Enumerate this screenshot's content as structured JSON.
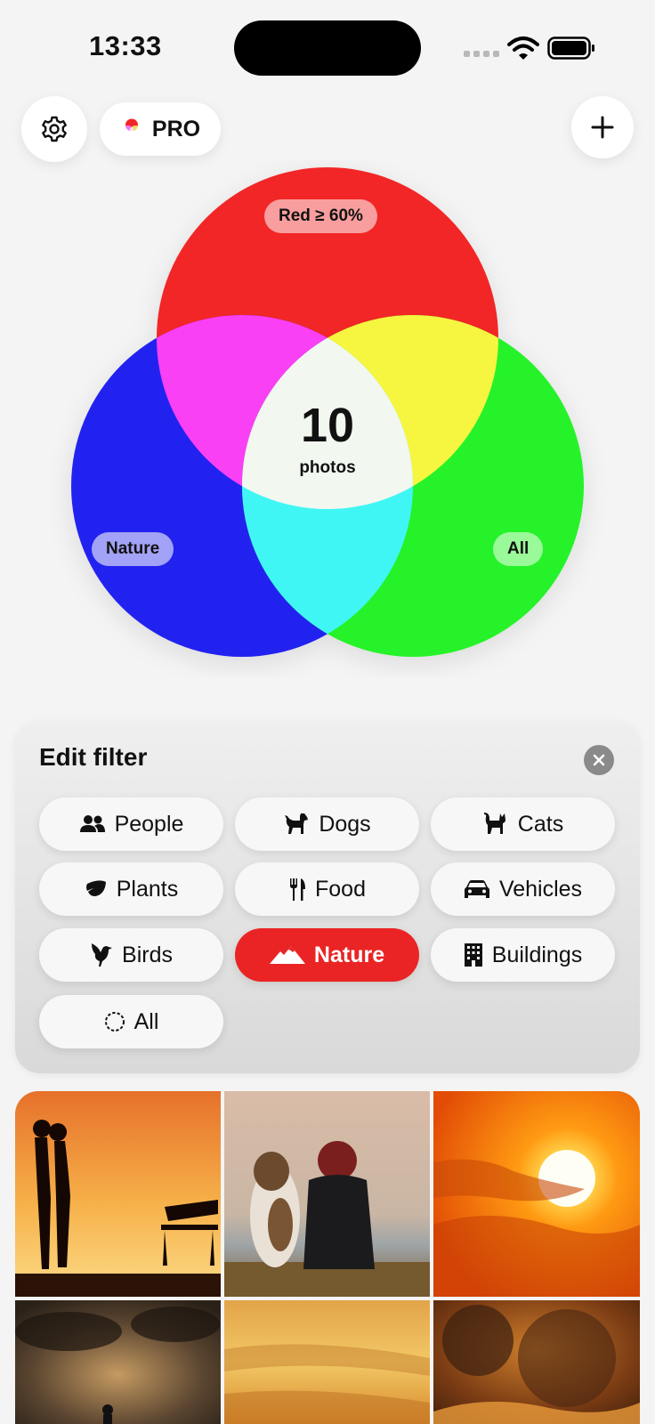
{
  "status": {
    "time": "13:33"
  },
  "toolbar": {
    "pro_label": "PRO"
  },
  "venn": {
    "labels": {
      "top": "Red ≥ 60%",
      "left": "Nature",
      "right": "All"
    },
    "count": "10",
    "count_unit": "photos",
    "colors": {
      "red": "#f22528",
      "green": "#25f22a",
      "blue": "#2222f0",
      "magenta": "#f940f5",
      "yellow": "#f6f640",
      "cyan": "#40f6f4",
      "center": "#f2f7f0"
    }
  },
  "filter": {
    "title": "Edit filter",
    "chips": [
      {
        "label": "People",
        "icon": "people-icon"
      },
      {
        "label": "Dogs",
        "icon": "dog-icon"
      },
      {
        "label": "Cats",
        "icon": "cat-icon"
      },
      {
        "label": "Plants",
        "icon": "leaf-icon"
      },
      {
        "label": "Food",
        "icon": "fork-knife-icon"
      },
      {
        "label": "Vehicles",
        "icon": "car-icon"
      },
      {
        "label": "Birds",
        "icon": "bird-icon"
      },
      {
        "label": "Nature",
        "icon": "mountain-icon",
        "selected": true
      },
      {
        "label": "Buildings",
        "icon": "building-icon"
      },
      {
        "label": "All",
        "icon": "dashed-circle-icon"
      }
    ],
    "accent": "#ea2424"
  },
  "photos": [
    {
      "name": "couple-silhouette-sunset"
    },
    {
      "name": "dog-and-woman-by-lake"
    },
    {
      "name": "bright-orange-sun"
    },
    {
      "name": "person-under-stormy-sky"
    },
    {
      "name": "golden-cloud-sky"
    },
    {
      "name": "dark-smoke-clouds"
    }
  ]
}
